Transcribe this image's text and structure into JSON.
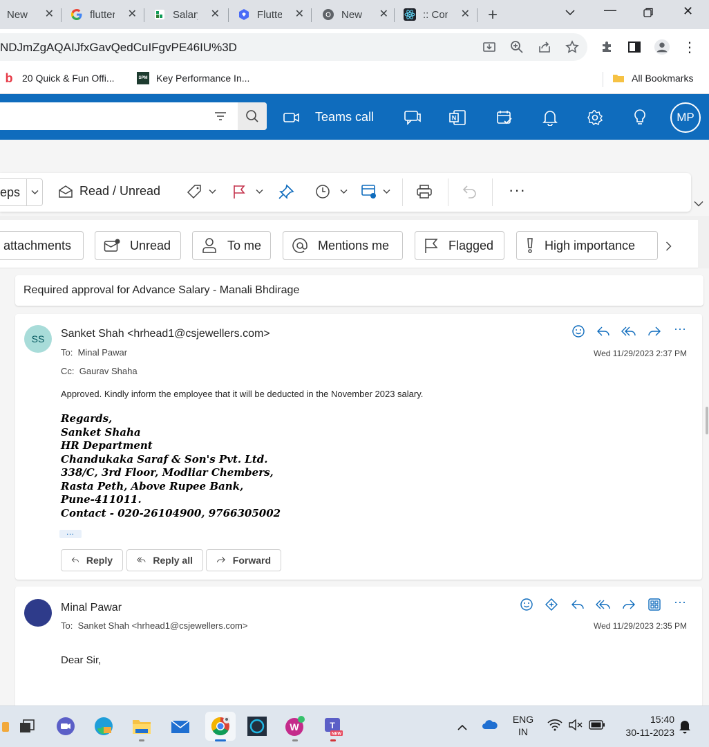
{
  "browser": {
    "tabs": [
      {
        "title": "New T",
        "favicon": "document-icon",
        "color": "#5f6368"
      },
      {
        "title": "flutter",
        "favicon": "google-icon",
        "color": "#4285f4"
      },
      {
        "title": "Salary",
        "favicon": "sheets-icon",
        "color": "#0f9d58"
      },
      {
        "title": "Flutter",
        "favicon": "flutter-icon",
        "color": "#4a6cf7"
      },
      {
        "title": "New",
        "favicon": "chrome-icon",
        "color": "#5f6368"
      },
      {
        "title": ":: Con",
        "favicon": "react-icon",
        "color": "#61dafb"
      }
    ],
    "url": "NDJmZgAQAIJfxGavQedCuIFgvPE46IU%3D",
    "bookmarks": [
      {
        "label": "20 Quick & Fun Offi...",
        "icon": "bold-b-icon"
      },
      {
        "label": "Key Performance In...",
        "icon": "spm-icon"
      }
    ],
    "all_bookmarks": "All Bookmarks"
  },
  "outlook": {
    "header": {
      "teams_call": "Teams call",
      "avatar_initials": "MP"
    },
    "ribbon": {
      "steps_label": "eps",
      "read_unread": "Read / Unread"
    },
    "filters": [
      {
        "label": "attachments",
        "icon": "paperclip-icon"
      },
      {
        "label": "Unread",
        "icon": "mail-unread-icon"
      },
      {
        "label": "To me",
        "icon": "person-icon"
      },
      {
        "label": "Mentions me",
        "icon": "at-icon"
      },
      {
        "label": "Flagged",
        "icon": "flag-icon"
      },
      {
        "label": "High importance",
        "icon": "importance-icon"
      }
    ],
    "subject": "Required approval for  Advance Salary - Manali Bhdirage",
    "messages": [
      {
        "initials": "SS",
        "avatar_color": "#a8dcd9",
        "from": "Sanket Shah <hrhead1@csjewellers.com>",
        "to_label": "To:",
        "to": "Minal Pawar",
        "cc_label": "Cc:",
        "cc": "Gaurav Shaha",
        "date": "Wed 11/29/2023 2:37 PM",
        "body": "Approved. Kindly inform the employee that it will be deducted in the November 2023 salary.",
        "signature": [
          "Regards,",
          "Sanket Shaha",
          "HR Department",
          "Chandukaka Saraf & Son's Pvt. Ltd.",
          "338/C, 3rd Floor, Modliar Chembers,",
          "Rasta Peth, Above Rupee Bank,",
          "Pune-411011.",
          "Contact - 020-26104900, 9766305002"
        ],
        "more": "…",
        "actions": {
          "reply": "Reply",
          "reply_all": "Reply all",
          "forward": "Forward"
        }
      },
      {
        "avatar_color": "#2e3b8a",
        "from": "Minal Pawar",
        "to_label": "To:",
        "to": "Sanket Shah <hrhead1@csjewellers.com>",
        "date": "Wed 11/29/2023 2:35 PM",
        "greeting": "Dear Sir,"
      }
    ]
  },
  "taskbar": {
    "lang_line1": "ENG",
    "lang_line2": "IN",
    "time": "15:40",
    "date": "30-11-2023"
  },
  "colors": {
    "accent": "#0f6cbd",
    "tabstrip": "#dee1e6"
  }
}
